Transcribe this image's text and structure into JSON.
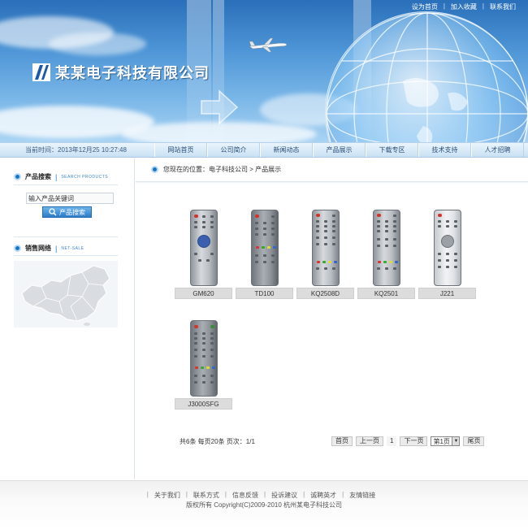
{
  "header": {
    "company_name": "某某电子科技有限公司",
    "top_links": [
      "设为首页",
      "加入收藏",
      "联系我们"
    ]
  },
  "navbar": {
    "date_text": "当前时间：2013年12月25 10:27:48",
    "items": [
      "网站首页",
      "公司简介",
      "新闻动态",
      "产品展示",
      "下载专区",
      "技术支持",
      "人才招聘"
    ]
  },
  "sidebar": {
    "search_title": "产品搜索",
    "search_title_en": "SEARCH PRODUCTS",
    "search_input_value": "输入产品关键词",
    "search_button": "产品搜索",
    "network_title": "销售网络",
    "network_title_en": "NET-SALE"
  },
  "breadcrumb": {
    "text": "您现在的位置：电子科技公司 > 产品展示"
  },
  "products": [
    {
      "name": "GM620"
    },
    {
      "name": "TD100"
    },
    {
      "name": "KQ2508D"
    },
    {
      "name": "KQ2501"
    },
    {
      "name": "J221"
    },
    {
      "name": "J3000SFG"
    }
  ],
  "pagination": {
    "summary": "共6条  每页20条  页次：1/1",
    "first": "首页",
    "prev": "上一页",
    "current": "1",
    "next": "下一页",
    "select_value": "第1页",
    "last": "尾页"
  },
  "footer": {
    "links": [
      "关于我们",
      "联系方式",
      "信息反馈",
      "投诉建议",
      "诚聘英才",
      "友情链接"
    ],
    "copyright": "版权所有 Copyright(C)2009-2010 杭州某电子科技公司"
  },
  "colors": {
    "brand_blue": "#1a74c4",
    "sky_top": "#2a6fb9",
    "nav_bg": "#d6e8f7"
  }
}
